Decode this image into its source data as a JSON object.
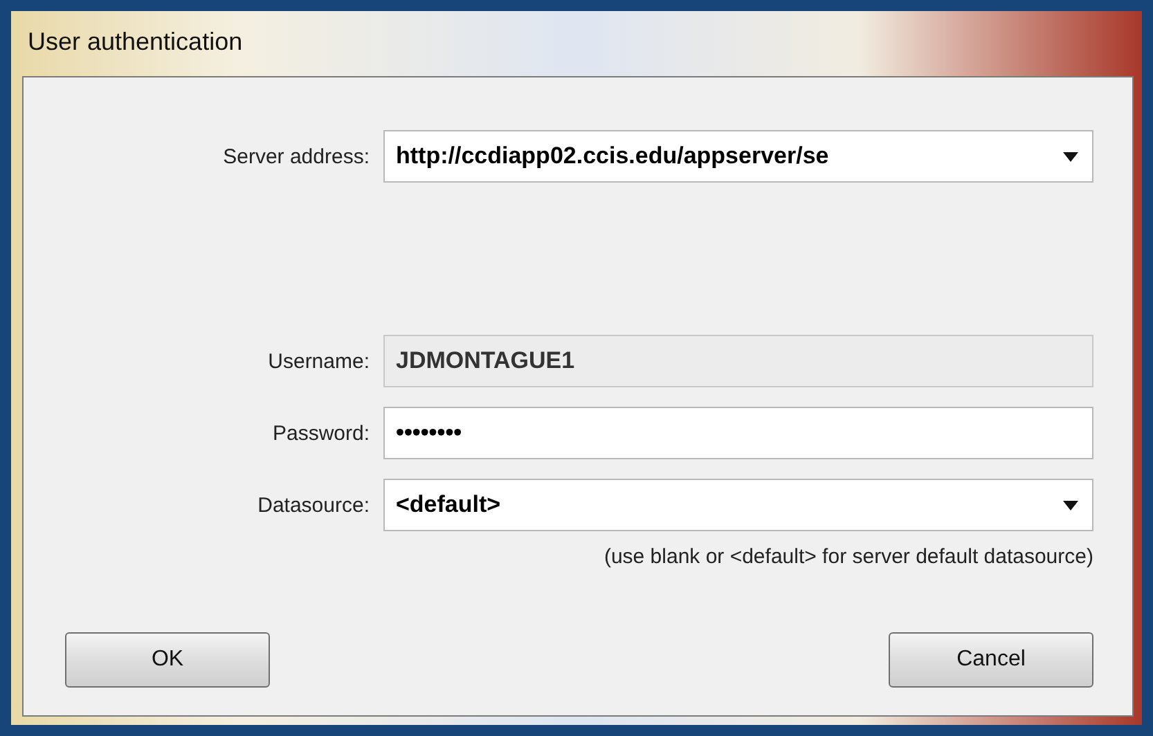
{
  "window": {
    "title": "User authentication"
  },
  "fields": [
    {
      "kind": "dropdown",
      "label": "Server address:",
      "value": "http://ccdiapp02.ccis.edu/appserver/se",
      "disabled": false
    },
    {
      "kind": "spacer"
    },
    {
      "kind": "text",
      "label": "Username:",
      "value": "JDMONTAGUE1",
      "disabled": true
    },
    {
      "kind": "text",
      "label": "Password:",
      "value": "••••••••",
      "disabled": false
    },
    {
      "kind": "dropdown",
      "label": "Datasource:",
      "value": "<default>",
      "disabled": false
    }
  ],
  "hint": "(use blank or <default> for server default datasource)",
  "buttons": [
    "OK",
    "Cancel"
  ]
}
